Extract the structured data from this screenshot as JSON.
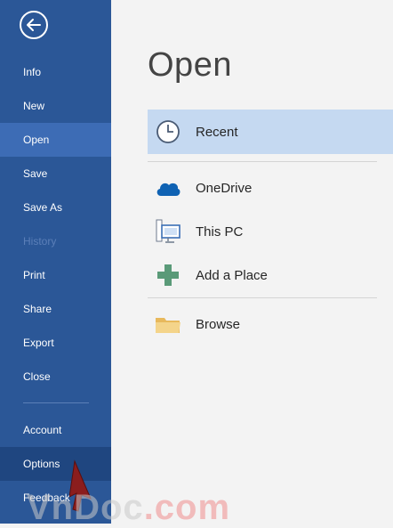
{
  "sidebar": {
    "back_icon": "back-arrow-icon",
    "items": [
      {
        "label": "Info"
      },
      {
        "label": "New"
      },
      {
        "label": "Open",
        "state": "active"
      },
      {
        "label": "Save"
      },
      {
        "label": "Save As"
      },
      {
        "label": "History",
        "state": "disabled"
      },
      {
        "label": "Print"
      },
      {
        "label": "Share"
      },
      {
        "label": "Export"
      },
      {
        "label": "Close"
      },
      {
        "label": "Account"
      },
      {
        "label": "Options",
        "state": "hover"
      },
      {
        "label": "Feedback"
      }
    ]
  },
  "main": {
    "title": "Open",
    "places": [
      {
        "label": "Recent",
        "icon": "clock-icon",
        "selected": true
      },
      {
        "label": "OneDrive",
        "icon": "cloud-icon"
      },
      {
        "label": "This PC",
        "icon": "computer-icon"
      },
      {
        "label": "Add a Place",
        "icon": "plus-icon"
      },
      {
        "label": "Browse",
        "icon": "folder-icon"
      }
    ]
  },
  "watermark": {
    "text_a": "VnDoc",
    "text_b": ".com"
  },
  "colors": {
    "sidebar": "#2b5797",
    "active": "#3d6cb5",
    "selected_place": "#c5d9f1"
  }
}
